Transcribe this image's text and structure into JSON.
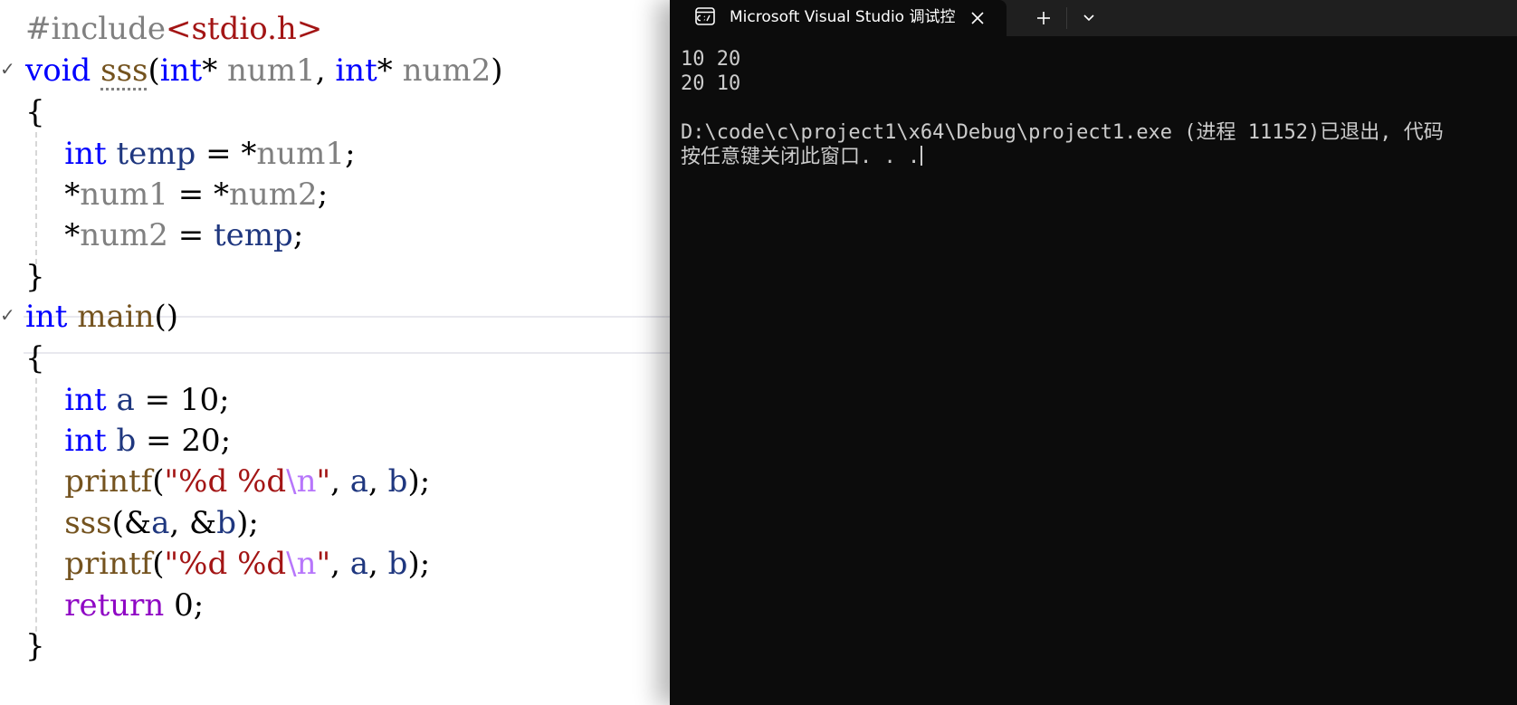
{
  "editor": {
    "colors": {
      "keyword": "#0000ff",
      "preprocessor": "#808080",
      "include_path": "#a31515",
      "function": "#74531f",
      "parameter": "#808080",
      "local_variable": "#1f377f",
      "string": "#a31515",
      "escape": "#b776fb",
      "control_keyword": "#8f08c4",
      "plain": "#000000"
    },
    "lines": [
      [
        {
          "t": "#include",
          "c": "preprocessor"
        },
        {
          "t": "<stdio.h>",
          "c": "include_path"
        }
      ],
      [
        {
          "t": "void",
          "c": "keyword"
        },
        {
          "t": " "
        },
        {
          "t": "sss",
          "c": "function",
          "squiggle": true
        },
        {
          "t": "("
        },
        {
          "t": "int",
          "c": "keyword"
        },
        {
          "t": "* "
        },
        {
          "t": "num1",
          "c": "parameter"
        },
        {
          "t": ", "
        },
        {
          "t": "int",
          "c": "keyword"
        },
        {
          "t": "* "
        },
        {
          "t": "num2",
          "c": "parameter"
        },
        {
          "t": ")"
        }
      ],
      [
        {
          "t": "{"
        }
      ],
      [
        {
          "t": "    "
        },
        {
          "t": "int",
          "c": "keyword"
        },
        {
          "t": " "
        },
        {
          "t": "temp",
          "c": "local_variable"
        },
        {
          "t": " = *"
        },
        {
          "t": "num1",
          "c": "parameter"
        },
        {
          "t": ";"
        }
      ],
      [
        {
          "t": "    *"
        },
        {
          "t": "num1",
          "c": "parameter"
        },
        {
          "t": " = *"
        },
        {
          "t": "num2",
          "c": "parameter"
        },
        {
          "t": ";"
        }
      ],
      [
        {
          "t": "    *"
        },
        {
          "t": "num2",
          "c": "parameter"
        },
        {
          "t": " = "
        },
        {
          "t": "temp",
          "c": "local_variable"
        },
        {
          "t": ";"
        }
      ],
      [
        {
          "t": "}"
        }
      ],
      [
        {
          "t": "int",
          "c": "keyword"
        },
        {
          "t": " "
        },
        {
          "t": "main",
          "c": "function"
        },
        {
          "t": "()"
        }
      ],
      [
        {
          "t": "{"
        }
      ],
      [
        {
          "t": "    "
        },
        {
          "t": "int",
          "c": "keyword"
        },
        {
          "t": " "
        },
        {
          "t": "a",
          "c": "local_variable"
        },
        {
          "t": " = 10;"
        }
      ],
      [
        {
          "t": "    "
        },
        {
          "t": "int",
          "c": "keyword"
        },
        {
          "t": " "
        },
        {
          "t": "b",
          "c": "local_variable"
        },
        {
          "t": " = 20;"
        }
      ],
      [
        {
          "t": "    "
        },
        {
          "t": "printf",
          "c": "function"
        },
        {
          "t": "("
        },
        {
          "t": "\"%d %d",
          "c": "string"
        },
        {
          "t": "\\n",
          "c": "escape"
        },
        {
          "t": "\"",
          "c": "string"
        },
        {
          "t": ", "
        },
        {
          "t": "a",
          "c": "local_variable"
        },
        {
          "t": ", "
        },
        {
          "t": "b",
          "c": "local_variable"
        },
        {
          "t": ");"
        }
      ],
      [
        {
          "t": "    "
        },
        {
          "t": "sss",
          "c": "function"
        },
        {
          "t": "(&"
        },
        {
          "t": "a",
          "c": "local_variable"
        },
        {
          "t": ", &"
        },
        {
          "t": "b",
          "c": "local_variable"
        },
        {
          "t": ");"
        }
      ],
      [
        {
          "t": "    "
        },
        {
          "t": "printf",
          "c": "function"
        },
        {
          "t": "("
        },
        {
          "t": "\"%d %d",
          "c": "string"
        },
        {
          "t": "\\n",
          "c": "escape"
        },
        {
          "t": "\"",
          "c": "string"
        },
        {
          "t": ", "
        },
        {
          "t": "a",
          "c": "local_variable"
        },
        {
          "t": ", "
        },
        {
          "t": "b",
          "c": "local_variable"
        },
        {
          "t": ");"
        }
      ],
      [
        {
          "t": "    "
        },
        {
          "t": "return",
          "c": "control_keyword"
        },
        {
          "t": " 0;"
        }
      ],
      [
        {
          "t": "}"
        }
      ]
    ]
  },
  "terminal": {
    "tab": {
      "icon": "console-icon",
      "title": "Microsoft Visual Studio 调试控",
      "close_icon": "close-icon"
    },
    "new_tab_icon": "plus-icon",
    "dropdown_icon": "chevron-down-icon",
    "colors": {
      "background": "#0c0c0c",
      "titlebar": "#1f1f1f",
      "text": "#cccccc"
    },
    "output": [
      "10 20",
      "20 10",
      "",
      "D:\\code\\c\\project1\\x64\\Debug\\project1.exe (进程 11152)已退出, 代码",
      "按任意键关闭此窗口. . ."
    ]
  }
}
